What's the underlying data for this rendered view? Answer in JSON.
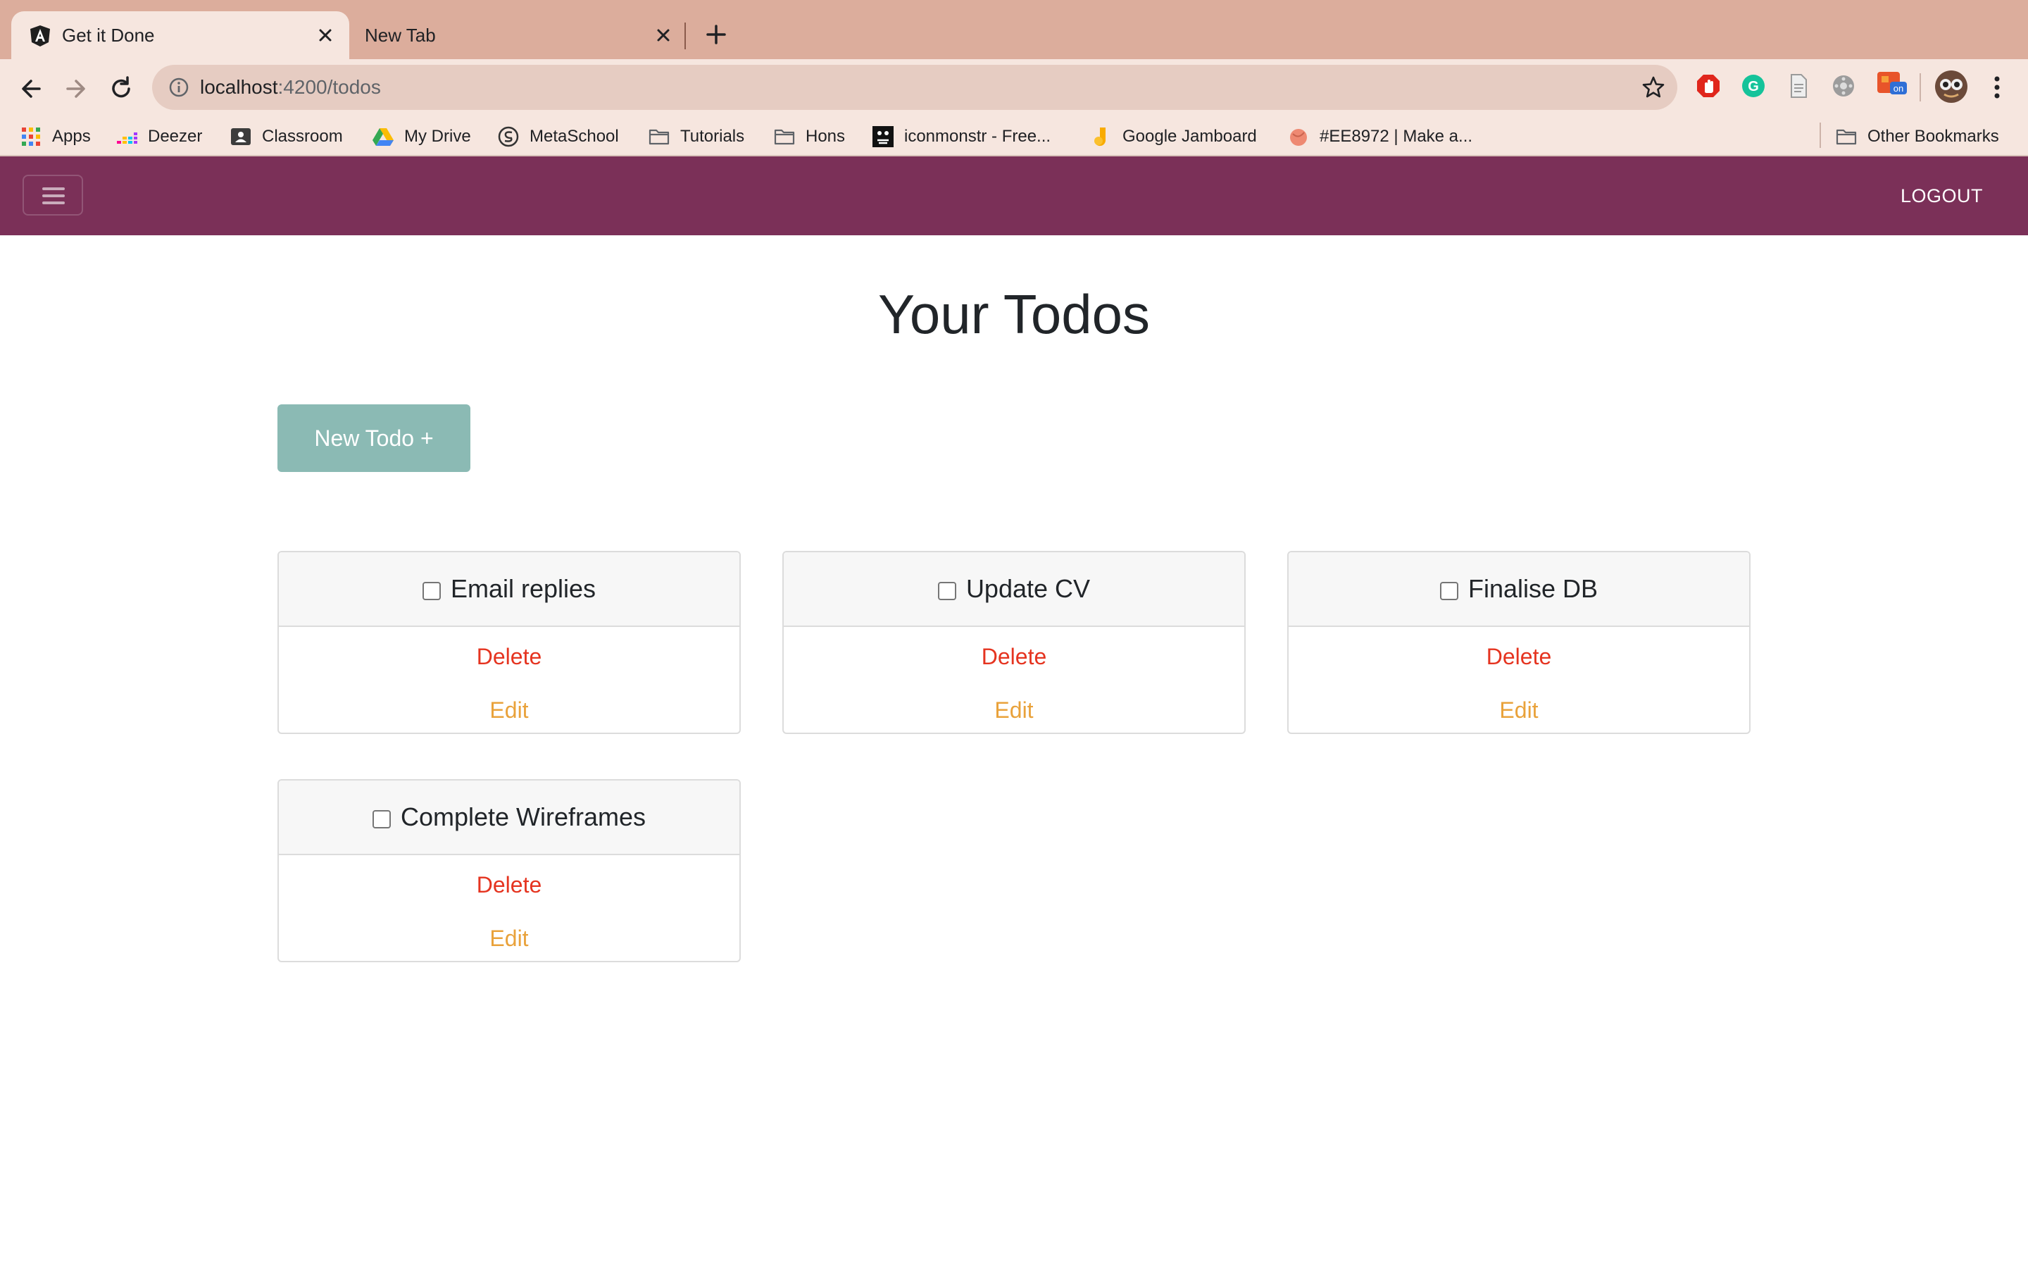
{
  "browser": {
    "tabs": [
      {
        "title": "Get it Done",
        "active": true
      },
      {
        "title": "New Tab",
        "active": false
      }
    ],
    "url": {
      "host": "localhost",
      "path": ":4200/todos"
    },
    "bookmarks": [
      {
        "label": "Apps",
        "icon": "apps-grid-icon"
      },
      {
        "label": "Deezer",
        "icon": "deezer-icon"
      },
      {
        "label": "Classroom",
        "icon": "classroom-icon"
      },
      {
        "label": "My Drive",
        "icon": "drive-icon"
      },
      {
        "label": "MetaSchool",
        "icon": "metaschool-icon"
      },
      {
        "label": "Tutorials",
        "icon": "folder-icon"
      },
      {
        "label": "Hons",
        "icon": "folder-icon"
      },
      {
        "label": "iconmonstr - Free...",
        "icon": "iconmonstr-icon"
      },
      {
        "label": "Google Jamboard",
        "icon": "jamboard-icon"
      },
      {
        "label": "#EE8972 | Make a...",
        "icon": "color-swatch-icon"
      }
    ],
    "other_bookmarks": "Other Bookmarks",
    "extension_badge": "on"
  },
  "app": {
    "logout_label": "LOGOUT",
    "page_title": "Your Todos",
    "new_todo_label": "New Todo +",
    "colors": {
      "navbar": "#7b3058",
      "new_todo_button": "#8bbab4",
      "delete": "#e53420",
      "edit": "#e9a23b"
    },
    "todos": [
      {
        "title": "Email replies",
        "delete_label": "Delete",
        "edit_label": "Edit",
        "checked": false
      },
      {
        "title": "Update CV",
        "delete_label": "Delete",
        "edit_label": "Edit",
        "checked": false
      },
      {
        "title": "Finalise DB",
        "delete_label": "Delete",
        "edit_label": "Edit",
        "checked": false
      },
      {
        "title": "Complete Wireframes",
        "delete_label": "Delete",
        "edit_label": "Edit",
        "checked": false
      }
    ]
  }
}
